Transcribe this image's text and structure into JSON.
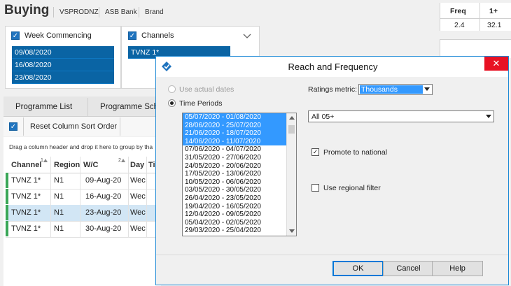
{
  "header": {
    "title": "Buying",
    "breadcrumbs": [
      "VSPRODNZ",
      "ASB Bank",
      "Brand"
    ]
  },
  "summary": {
    "headers": [
      "Freq",
      "1+"
    ],
    "values": [
      "2.4",
      "32.1"
    ]
  },
  "week_panel": {
    "title": "Week Commencing",
    "items": [
      "09/08/2020",
      "16/08/2020",
      "23/08/2020"
    ]
  },
  "channels_panel": {
    "title": "Channels",
    "items": [
      "TVNZ 1*"
    ]
  },
  "tabs": [
    "Programme List",
    "Programme Sch"
  ],
  "toolbar": {
    "reset_label": "Reset Column Sort Order"
  },
  "group_hint": "Drag a column header and drop it here to group by tha",
  "grid": {
    "columns": [
      "Channel",
      "Region",
      "W/C",
      "Day",
      "Ti"
    ],
    "sort_marks": [
      "1",
      "2"
    ],
    "rows": [
      {
        "channel": "TVNZ 1*",
        "region": "N1",
        "wc": "09-Aug-20",
        "day": "Wec"
      },
      {
        "channel": "TVNZ 1*",
        "region": "N1",
        "wc": "16-Aug-20",
        "day": "Wec"
      },
      {
        "channel": "TVNZ 1*",
        "region": "N1",
        "wc": "23-Aug-20",
        "day": "Wec"
      },
      {
        "channel": "TVNZ 1*",
        "region": "N1",
        "wc": "30-Aug-20",
        "day": "Wec"
      }
    ]
  },
  "dialog": {
    "title": "Reach and Frequency",
    "close_glyph": "✕",
    "use_actual_dates": "Use actual dates",
    "time_periods": "Time Periods",
    "ratings_metric_label": "Ratings metric:",
    "ratings_metric_value": "Thousands",
    "demographic_value": "All 05+",
    "promote_label": "Promote to national",
    "promote_checked": true,
    "regional_label": "Use regional filter",
    "regional_checked": false,
    "periods": [
      "05/07/2020 - 01/08/2020",
      "28/06/2020 - 25/07/2020",
      "21/06/2020 - 18/07/2020",
      "14/06/2020 - 11/07/2020",
      "07/06/2020 - 04/07/2020",
      "31/05/2020 - 27/06/2020",
      "24/05/2020 - 20/06/2020",
      "17/05/2020 - 13/06/2020",
      "10/05/2020 - 06/06/2020",
      "03/05/2020 - 30/05/2020",
      "26/04/2020 - 23/05/2020",
      "19/04/2020 - 16/05/2020",
      "12/04/2020 - 09/05/2020",
      "05/04/2020 - 02/05/2020",
      "29/03/2020 - 25/04/2020"
    ],
    "selected_period_count": 4,
    "buttons": {
      "ok": "OK",
      "cancel": "Cancel",
      "help": "Help"
    }
  },
  "colors": {
    "selection": "#0a64a4",
    "list_selection": "#3399ff",
    "accent_green": "#3aa757",
    "dialog_border": "#1e8ad6"
  }
}
